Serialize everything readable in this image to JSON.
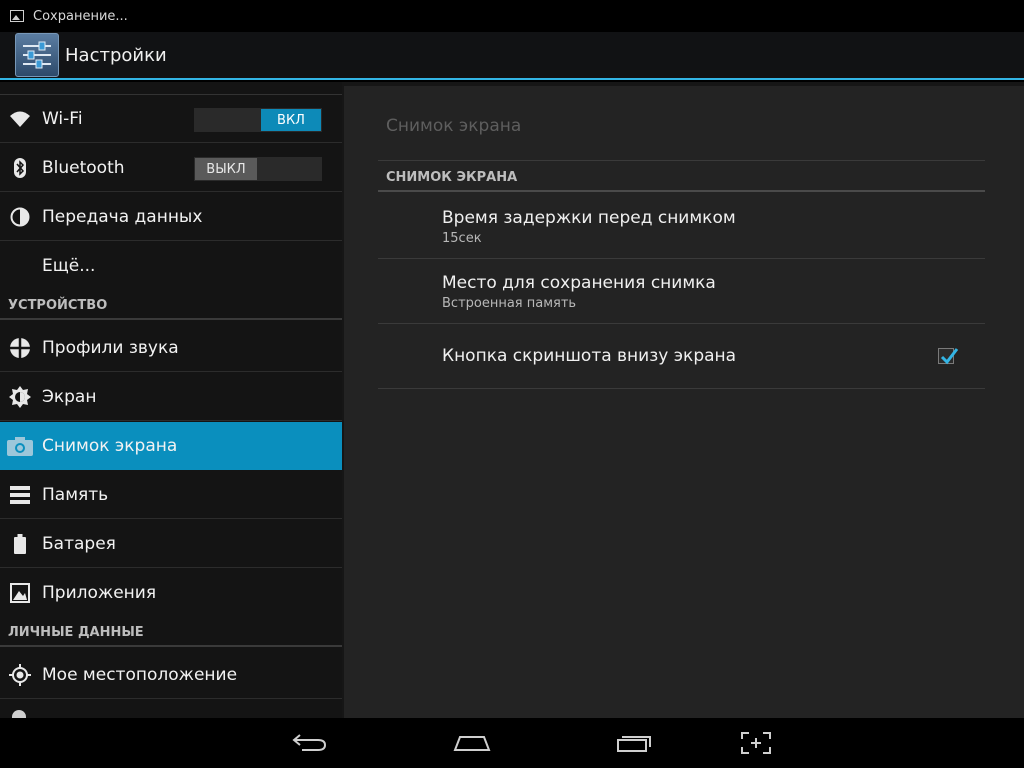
{
  "status_bar": {
    "notification_text": "Сохранение...",
    "notification_icon": "image-icon"
  },
  "action_bar": {
    "title": "Настройки",
    "app_icon": "settings-sliders-icon"
  },
  "sidebar": {
    "items": [
      {
        "label": "Wi-Fi",
        "icon": "wifi-icon",
        "toggle": "on",
        "toggle_label": "ВКЛ"
      },
      {
        "label": "Bluetooth",
        "icon": "bluetooth-icon",
        "toggle": "off",
        "toggle_label": "ВЫКЛ"
      },
      {
        "label": "Передача данных",
        "icon": "data-usage-icon"
      },
      {
        "label": "Ещё..."
      },
      {
        "label": "Профили звука",
        "icon": "sound-profiles-icon"
      },
      {
        "label": "Экран",
        "icon": "display-icon"
      },
      {
        "label": "Снимок экрана",
        "icon": "camera-icon",
        "selected": true
      },
      {
        "label": "Память",
        "icon": "storage-icon"
      },
      {
        "label": "Батарея",
        "icon": "battery-icon"
      },
      {
        "label": "Приложения",
        "icon": "apps-icon"
      },
      {
        "label": "Мое местоположение",
        "icon": "location-icon"
      }
    ],
    "sections": [
      "УСТРОЙСТВО",
      "ЛИЧНЫЕ ДАННЫЕ"
    ]
  },
  "detail": {
    "title": "Снимок экрана",
    "section_header": "СНИМОК ЭКРАНА",
    "prefs": [
      {
        "title": "Время задержки перед снимком",
        "summary": "15сек"
      },
      {
        "title": "Место для сохранения снимка",
        "summary": "Встроенная память"
      },
      {
        "title": "Кнопка скриншота внизу экрана",
        "checked": true
      }
    ]
  },
  "nav_bar": {
    "buttons": [
      "back-icon",
      "home-icon",
      "recents-icon",
      "screenshot-icon"
    ]
  },
  "colors": {
    "accent": "#33b5e5",
    "selected": "#0a8fbe",
    "toggle_on": "#0d8ab8"
  }
}
